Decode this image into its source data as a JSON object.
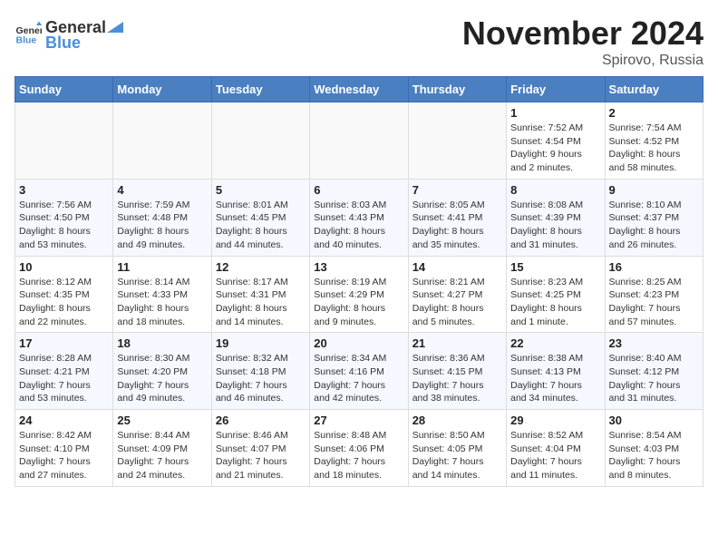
{
  "header": {
    "logo_general": "General",
    "logo_blue": "Blue",
    "month": "November 2024",
    "location": "Spirovo, Russia"
  },
  "weekdays": [
    "Sunday",
    "Monday",
    "Tuesday",
    "Wednesday",
    "Thursday",
    "Friday",
    "Saturday"
  ],
  "weeks": [
    [
      {
        "day": "",
        "info": ""
      },
      {
        "day": "",
        "info": ""
      },
      {
        "day": "",
        "info": ""
      },
      {
        "day": "",
        "info": ""
      },
      {
        "day": "",
        "info": ""
      },
      {
        "day": "1",
        "info": "Sunrise: 7:52 AM\nSunset: 4:54 PM\nDaylight: 9 hours\nand 2 minutes."
      },
      {
        "day": "2",
        "info": "Sunrise: 7:54 AM\nSunset: 4:52 PM\nDaylight: 8 hours\nand 58 minutes."
      }
    ],
    [
      {
        "day": "3",
        "info": "Sunrise: 7:56 AM\nSunset: 4:50 PM\nDaylight: 8 hours\nand 53 minutes."
      },
      {
        "day": "4",
        "info": "Sunrise: 7:59 AM\nSunset: 4:48 PM\nDaylight: 8 hours\nand 49 minutes."
      },
      {
        "day": "5",
        "info": "Sunrise: 8:01 AM\nSunset: 4:45 PM\nDaylight: 8 hours\nand 44 minutes."
      },
      {
        "day": "6",
        "info": "Sunrise: 8:03 AM\nSunset: 4:43 PM\nDaylight: 8 hours\nand 40 minutes."
      },
      {
        "day": "7",
        "info": "Sunrise: 8:05 AM\nSunset: 4:41 PM\nDaylight: 8 hours\nand 35 minutes."
      },
      {
        "day": "8",
        "info": "Sunrise: 8:08 AM\nSunset: 4:39 PM\nDaylight: 8 hours\nand 31 minutes."
      },
      {
        "day": "9",
        "info": "Sunrise: 8:10 AM\nSunset: 4:37 PM\nDaylight: 8 hours\nand 26 minutes."
      }
    ],
    [
      {
        "day": "10",
        "info": "Sunrise: 8:12 AM\nSunset: 4:35 PM\nDaylight: 8 hours\nand 22 minutes."
      },
      {
        "day": "11",
        "info": "Sunrise: 8:14 AM\nSunset: 4:33 PM\nDaylight: 8 hours\nand 18 minutes."
      },
      {
        "day": "12",
        "info": "Sunrise: 8:17 AM\nSunset: 4:31 PM\nDaylight: 8 hours\nand 14 minutes."
      },
      {
        "day": "13",
        "info": "Sunrise: 8:19 AM\nSunset: 4:29 PM\nDaylight: 8 hours\nand 9 minutes."
      },
      {
        "day": "14",
        "info": "Sunrise: 8:21 AM\nSunset: 4:27 PM\nDaylight: 8 hours\nand 5 minutes."
      },
      {
        "day": "15",
        "info": "Sunrise: 8:23 AM\nSunset: 4:25 PM\nDaylight: 8 hours\nand 1 minute."
      },
      {
        "day": "16",
        "info": "Sunrise: 8:25 AM\nSunset: 4:23 PM\nDaylight: 7 hours\nand 57 minutes."
      }
    ],
    [
      {
        "day": "17",
        "info": "Sunrise: 8:28 AM\nSunset: 4:21 PM\nDaylight: 7 hours\nand 53 minutes."
      },
      {
        "day": "18",
        "info": "Sunrise: 8:30 AM\nSunset: 4:20 PM\nDaylight: 7 hours\nand 49 minutes."
      },
      {
        "day": "19",
        "info": "Sunrise: 8:32 AM\nSunset: 4:18 PM\nDaylight: 7 hours\nand 46 minutes."
      },
      {
        "day": "20",
        "info": "Sunrise: 8:34 AM\nSunset: 4:16 PM\nDaylight: 7 hours\nand 42 minutes."
      },
      {
        "day": "21",
        "info": "Sunrise: 8:36 AM\nSunset: 4:15 PM\nDaylight: 7 hours\nand 38 minutes."
      },
      {
        "day": "22",
        "info": "Sunrise: 8:38 AM\nSunset: 4:13 PM\nDaylight: 7 hours\nand 34 minutes."
      },
      {
        "day": "23",
        "info": "Sunrise: 8:40 AM\nSunset: 4:12 PM\nDaylight: 7 hours\nand 31 minutes."
      }
    ],
    [
      {
        "day": "24",
        "info": "Sunrise: 8:42 AM\nSunset: 4:10 PM\nDaylight: 7 hours\nand 27 minutes."
      },
      {
        "day": "25",
        "info": "Sunrise: 8:44 AM\nSunset: 4:09 PM\nDaylight: 7 hours\nand 24 minutes."
      },
      {
        "day": "26",
        "info": "Sunrise: 8:46 AM\nSunset: 4:07 PM\nDaylight: 7 hours\nand 21 minutes."
      },
      {
        "day": "27",
        "info": "Sunrise: 8:48 AM\nSunset: 4:06 PM\nDaylight: 7 hours\nand 18 minutes."
      },
      {
        "day": "28",
        "info": "Sunrise: 8:50 AM\nSunset: 4:05 PM\nDaylight: 7 hours\nand 14 minutes."
      },
      {
        "day": "29",
        "info": "Sunrise: 8:52 AM\nSunset: 4:04 PM\nDaylight: 7 hours\nand 11 minutes."
      },
      {
        "day": "30",
        "info": "Sunrise: 8:54 AM\nSunset: 4:03 PM\nDaylight: 7 hours\nand 8 minutes."
      }
    ]
  ]
}
